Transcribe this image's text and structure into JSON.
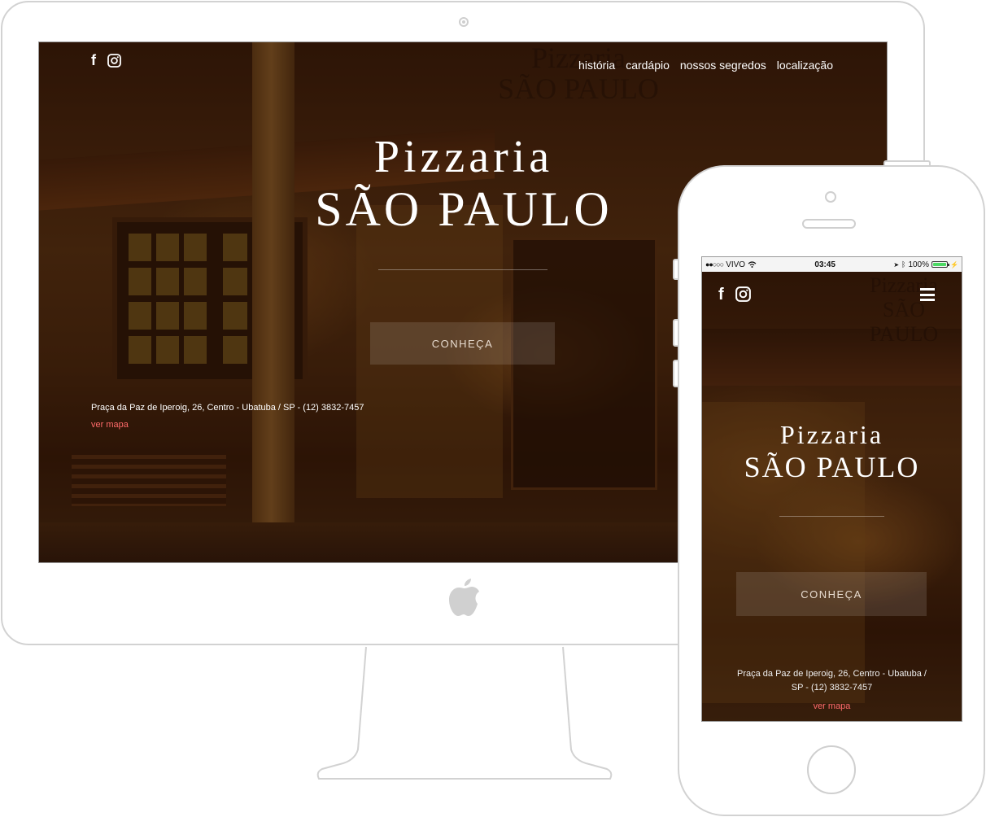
{
  "desktop": {
    "social": {
      "facebook": "f"
    },
    "nav": [
      "história",
      "cardápio",
      "nossos segredos",
      "localização"
    ],
    "title_line1": "Pizzaria",
    "title_line2": "SÃO PAULO",
    "cta_label": "CONHEÇA",
    "address": "Praça da Paz de Iperoig, 26, Centro - Ubatuba / SP - (12) 3832-7457",
    "map_link": "ver mapa",
    "sign_line1": "Pizzaria",
    "sign_line2": "SÃO PAULO"
  },
  "mobile": {
    "status": {
      "carrier": "VIVO",
      "time": "03:45",
      "battery": "100%"
    },
    "social": {
      "facebook": "f"
    },
    "title_line1": "Pizzaria",
    "title_line2": "SÃO PAULO",
    "cta_label": "CONHEÇA",
    "address": "Praça da Paz de Iperoig, 26, Centro - Ubatuba / SP - (12) 3832-7457",
    "map_link": "ver mapa",
    "sign_line1": "Pizzaria",
    "sign_line2": "SÃO PAULO"
  },
  "colors": {
    "link": "#ff6a6a",
    "device_outline": "#d2d2d2",
    "battery": "#4cd964"
  }
}
